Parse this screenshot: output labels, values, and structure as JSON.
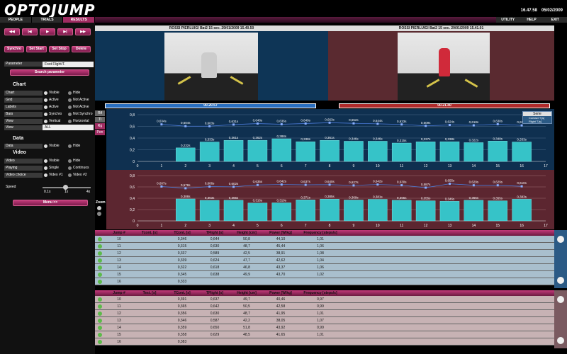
{
  "app": {
    "logo": "OPTOJUMP",
    "time": "16.47.58",
    "date": "05/02/2009"
  },
  "nav": {
    "left": [
      "PEOPLE",
      "TRIALS",
      "RESULTS"
    ],
    "right": [
      "UTILITY",
      "HELP",
      "EXIT"
    ]
  },
  "media": {
    "b1": "◀◀",
    "b2": "|◀",
    "b3": "▶",
    "b4": "▶|",
    "b5": "▶▶"
  },
  "actions": {
    "synchro": "Synchro",
    "set_start": "Set Start",
    "set_stop": "Set Stop",
    "delete": "Delete"
  },
  "parameter": {
    "label": "Parameter",
    "value": "Foot Flight/T.",
    "search": "Search parameter"
  },
  "chart_section": {
    "title": "Chart",
    "rows": [
      {
        "label": "Chart",
        "o1": "Visible",
        "o2": "Hide"
      },
      {
        "label": "Grid",
        "o1": "Active",
        "o2": "Not Active"
      },
      {
        "label": "Labels",
        "o1": "Active",
        "o2": "Not Active"
      },
      {
        "label": "Bars",
        "o1": "Synchro",
        "o2": "Not Synchro"
      },
      {
        "label": "View",
        "o1": "Vertical",
        "o2": "Horizontal"
      }
    ],
    "view_label": "View",
    "view_value": "ALL"
  },
  "data_section": {
    "title": "Data",
    "label": "Data",
    "o1": "Visible",
    "o2": "Hide"
  },
  "video_section": {
    "title": "Video",
    "rows": [
      {
        "label": "Video",
        "o1": "Visible",
        "o2": "Hide"
      },
      {
        "label": "Playing",
        "o1": "Single",
        "o2": "Continuos"
      },
      {
        "label": "Video choice",
        "o1": "Video #1",
        "o2": "Video #2"
      }
    ],
    "speed": "Speed",
    "s1": "0.1x",
    "s2": "1x",
    "s3": "4x",
    "menu": "Menu >>"
  },
  "video1": {
    "title": "ROSSI PIERLUIGI Bat2 15 sec. 29/01/2009 15.40.50",
    "time": "00.20.57",
    "progress": 1.0
  },
  "video2": {
    "title": "ROSSI PIERLUIGI Bat2 15 sec. 29/01/2009 15.41.01",
    "time": "00.21.40",
    "progress": 1.0
  },
  "side": {
    "b1": "Rif",
    "b2": "Ti",
    "b3": "Rg",
    "b4": "Pen",
    "zoom": "Zoom"
  },
  "legend": {
    "title": "Serie",
    "s1": "Contact T.[s]",
    "s2": "Flight T.[s]"
  },
  "chart_data": [
    {
      "type": "bar",
      "x": [
        2,
        3,
        4,
        5,
        6,
        7,
        8,
        9,
        10,
        11,
        12,
        13,
        14,
        15,
        16
      ],
      "values": [
        0.232,
        0.333,
        0.361,
        0.362,
        0.388,
        0.338,
        0.361,
        0.346,
        0.346,
        0.315,
        0.337,
        0.338,
        0.322,
        0.348,
        0.333
      ],
      "bar_labels": [
        "0,232s",
        "0,333s",
        "0,361s",
        "0,362s",
        "0,388s",
        "0,338s",
        "0,361s",
        "0,346s",
        "0,346s",
        "0,315s",
        "0,337s",
        "0,338s",
        "0,322s",
        "0,348s",
        "0,333s"
      ],
      "line_x": [
        1,
        2,
        3,
        4,
        5,
        6,
        7,
        8,
        9,
        10,
        11,
        12,
        13,
        14,
        15,
        16
      ],
      "line_values": [
        0.634,
        0.604,
        0.603,
        0.631,
        0.648,
        0.636,
        0.649,
        0.663,
        0.652,
        0.644,
        0.633,
        0.609,
        0.624,
        0.618,
        0.638,
        0.617
      ],
      "line_labels": [
        "0,634s",
        "0,604s",
        "0,603s",
        "0,631s",
        "0,648s",
        "0,636s",
        "0,649s",
        "0,663s",
        "0,652s",
        "0,644s",
        "0,633s",
        "0,609s",
        "0,624s",
        "0,618s",
        "0,638s",
        "0,617s"
      ],
      "xlim": [
        0,
        17
      ],
      "ylim": [
        0,
        0.8
      ],
      "xticks": [
        "0",
        "1",
        "2",
        "3",
        "4",
        "5",
        "6",
        "7",
        "8",
        "9",
        "10",
        "11",
        "12",
        "13",
        "14",
        "15",
        "16",
        "17"
      ],
      "yticks": [
        "0",
        "0,2",
        "0,4",
        "0,6",
        "0,8"
      ]
    },
    {
      "type": "bar",
      "x": [
        2,
        3,
        4,
        5,
        6,
        7,
        8,
        9,
        10,
        11,
        12,
        13,
        14,
        15,
        16
      ],
      "values": [
        0.388,
        0.363,
        0.365,
        0.316,
        0.319,
        0.371,
        0.385,
        0.369,
        0.381,
        0.365,
        0.355,
        0.346,
        0.365,
        0.355,
        0.383
      ],
      "bar_labels": [
        "0,388s",
        "0,363s",
        "0,365s",
        "0,316s",
        "0,319s",
        "0,371s",
        "0,385s",
        "0,369s",
        "0,381s",
        "0,365s",
        "0,355s",
        "0,346s",
        "0,365s",
        "0,355s",
        "0,383s"
      ],
      "line_x": [
        1,
        2,
        3,
        4,
        5,
        6,
        7,
        8,
        9,
        10,
        11,
        12,
        13,
        14,
        15,
        16
      ],
      "line_values": [
        0.607,
        0.576,
        0.606,
        0.602,
        0.635,
        0.642,
        0.637,
        0.64,
        0.627,
        0.642,
        0.63,
        0.587,
        0.655,
        0.629,
        0.629,
        0.61
      ],
      "line_labels": [
        "0,607s",
        "0,578s",
        "0,606s",
        "0,602s",
        "0,635s",
        "0,642s",
        "0,637s",
        "0,640s",
        "0,627s",
        "0,642s",
        "0,630s",
        "0,587s",
        "0,655s",
        "0,629s",
        "0,629s",
        "0,610s"
      ],
      "xlim": [
        0,
        17
      ],
      "ylim": [
        0,
        0.8
      ],
      "xticks": [
        "0",
        "1",
        "2",
        "3",
        "4",
        "5",
        "6",
        "7",
        "8",
        "9",
        "10",
        "11",
        "12",
        "13",
        "14",
        "15",
        "16",
        "17"
      ],
      "yticks": [
        "0",
        "0,2",
        "0,4",
        "0,6",
        "0,8"
      ]
    }
  ],
  "table1": {
    "cols": [
      "",
      "Jump #",
      "Tcont. [s]",
      "TCont. [s]",
      "TFlight [s]",
      "Height [cm]",
      "Power [W/kg]",
      "Frequency [steps/s]"
    ],
    "rows": [
      [
        "10",
        "",
        "0,346",
        "0,644",
        "50,8",
        "44,10",
        "1,01"
      ],
      [
        "11",
        "",
        "0,315",
        "0,630",
        "48,7",
        "45,44",
        "1,06"
      ],
      [
        "12",
        "",
        "0,337",
        "0,589",
        "42,5",
        "38,91",
        "1,08"
      ],
      [
        "13",
        "",
        "0,339",
        "0,624",
        "47,7",
        "42,62",
        "1,04"
      ],
      [
        "14",
        "",
        "0,322",
        "0,618",
        "46,8",
        "43,37",
        "1,06"
      ],
      [
        "15",
        "",
        "0,345",
        "0,638",
        "49,9",
        "43,70",
        "1,02"
      ],
      [
        "16",
        "",
        "0,333",
        "",
        "",
        "",
        ""
      ]
    ]
  },
  "table2": {
    "cols": [
      "",
      "Jump #",
      "Test. [s]",
      "TCont. [s]",
      "TFlight [s]",
      "Height [cm]",
      "Power [W/kg]",
      "Frequency [steps/s]"
    ],
    "rows": [
      [
        "10",
        "",
        "0,391",
        "0,637",
        "49,7",
        "40,46",
        "0,97"
      ],
      [
        "11",
        "",
        "0,365",
        "0,642",
        "50,5",
        "42,58",
        "0,99"
      ],
      [
        "12",
        "",
        "0,356",
        "0,630",
        "48,7",
        "41,95",
        "1,01"
      ],
      [
        "13",
        "",
        "0,346",
        "0,587",
        "42,2",
        "38,05",
        "1,07"
      ],
      [
        "14",
        "",
        "0,359",
        "0,650",
        "51,8",
        "43,92",
        "0,99"
      ],
      [
        "15",
        "",
        "0,358",
        "0,629",
        "48,5",
        "41,65",
        "1,01"
      ],
      [
        "16",
        "",
        "0,383",
        "",
        "",
        "",
        ""
      ]
    ]
  }
}
